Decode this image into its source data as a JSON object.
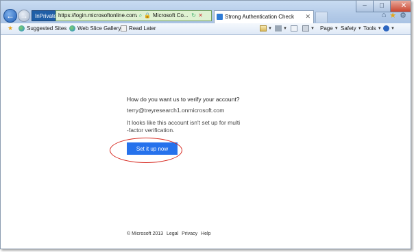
{
  "browser": {
    "inprivate_label": "InPrivate",
    "address_url": "https://login.microsoftonline.com/",
    "cert_name": "Microsoft Co...",
    "tab_title": "Strong Authentication Check"
  },
  "favorites_bar": {
    "items": [
      {
        "label": "Suggested Sites",
        "icon": "ie-icon"
      },
      {
        "label": "Web Slice Gallery",
        "icon": "ie-icon"
      },
      {
        "label": "Read Later",
        "icon": "page-icon"
      }
    ]
  },
  "command_bar": {
    "page_label": "Page",
    "safety_label": "Safety",
    "tools_label": "Tools"
  },
  "page": {
    "heading": "How do you want us to verify your account?",
    "account": "terry@treyresearch1.onmicrosoft.com",
    "message_line1": "It looks like this account isn't set up for multi",
    "message_line2": "-factor verification.",
    "setup_button": "Set it up now"
  },
  "footer": {
    "copyright": "© Microsoft 2013",
    "links": [
      "Legal",
      "Privacy",
      "Help"
    ]
  },
  "colors": {
    "button_blue": "#2672ec",
    "annotation_red": "#d6261d",
    "address_green": "#dff1d2"
  }
}
